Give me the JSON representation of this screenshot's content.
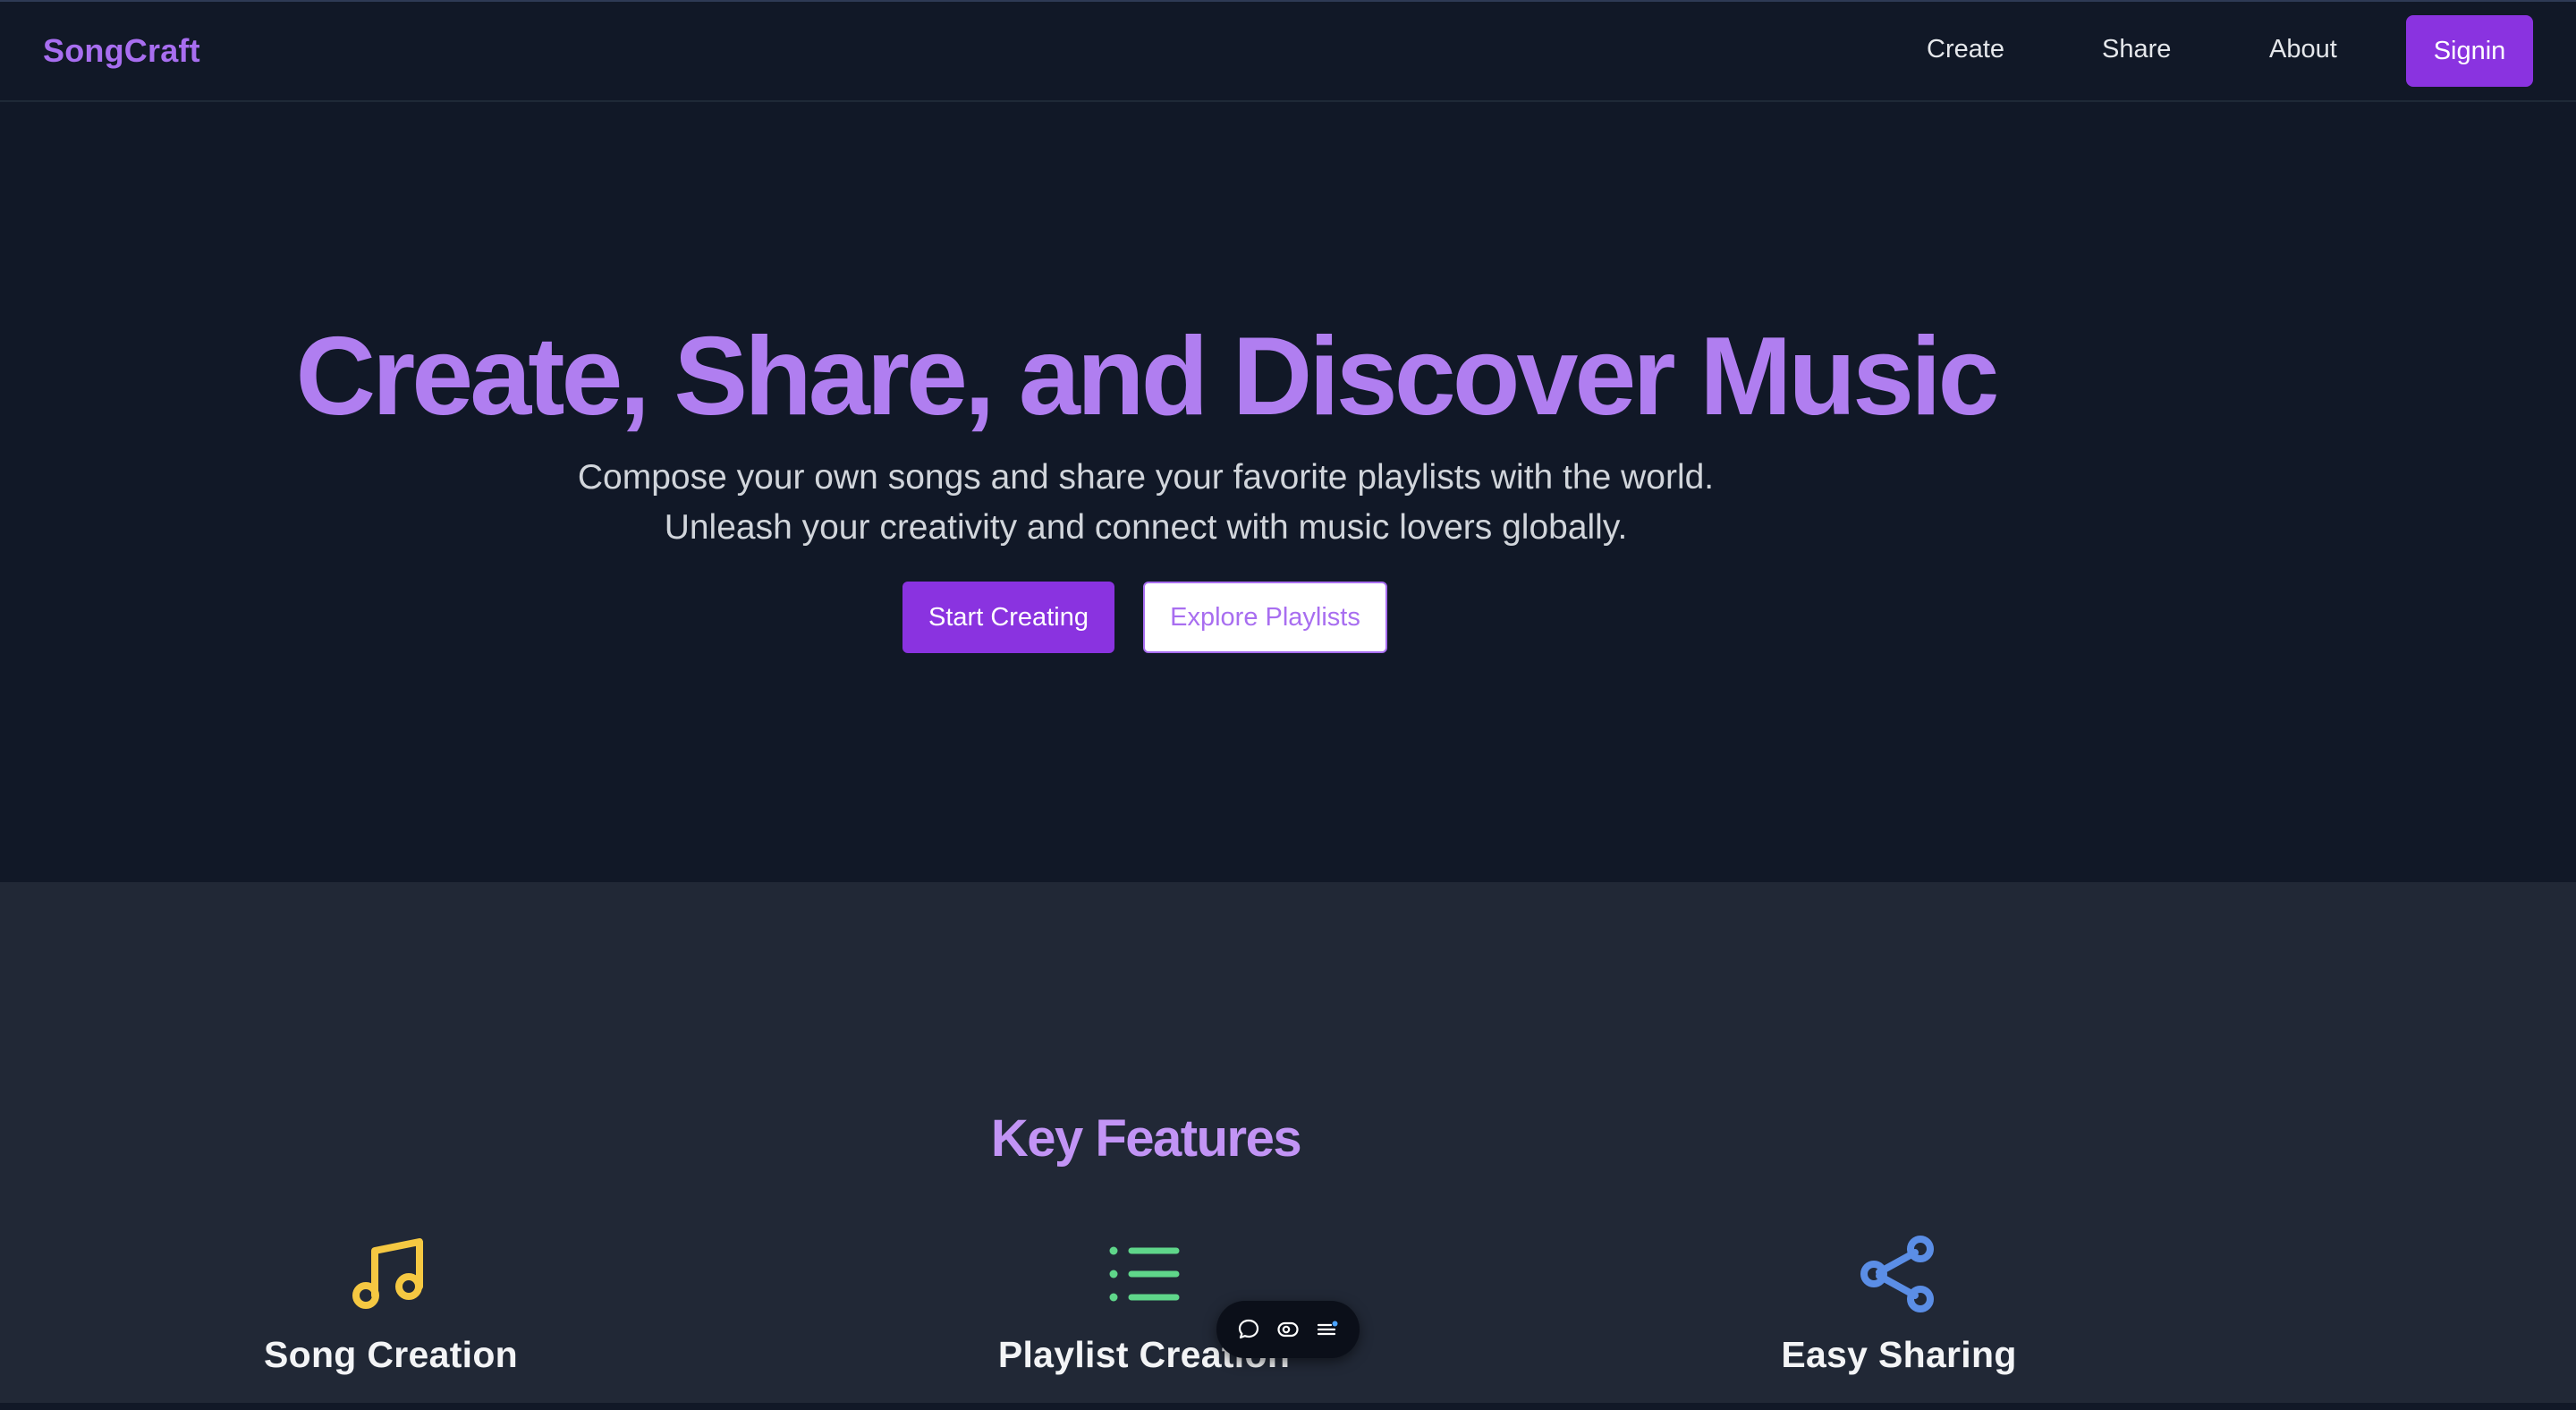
{
  "brand": "SongCraft",
  "nav": {
    "create": "Create",
    "share": "Share",
    "about": "About",
    "signin": "Signin"
  },
  "hero": {
    "title": "Create, Share, and Discover Music",
    "subtitle_line1": "Compose your own songs and share your favorite playlists with the world.",
    "subtitle_line2": "Unleash your creativity and connect with music lovers globally.",
    "primary_button": "Start Creating",
    "secondary_button": "Explore Playlists"
  },
  "features": {
    "title": "Key Features",
    "items": [
      {
        "title": "Song Creation",
        "icon": "music-note-icon"
      },
      {
        "title": "Playlist Creation",
        "icon": "list-icon"
      },
      {
        "title": "Easy Sharing",
        "icon": "share-icon"
      }
    ]
  },
  "floating_toolbar": {
    "icons": [
      "comment-icon",
      "eye-icon",
      "menu-icon"
    ]
  },
  "colors": {
    "background": "#111827",
    "section_background": "#212836",
    "accent": "#8a33e0",
    "brand_text": "#a86ef0",
    "music_icon": "#f5c842",
    "list_icon": "#5fd68a",
    "share_icon": "#5b8ee6"
  }
}
